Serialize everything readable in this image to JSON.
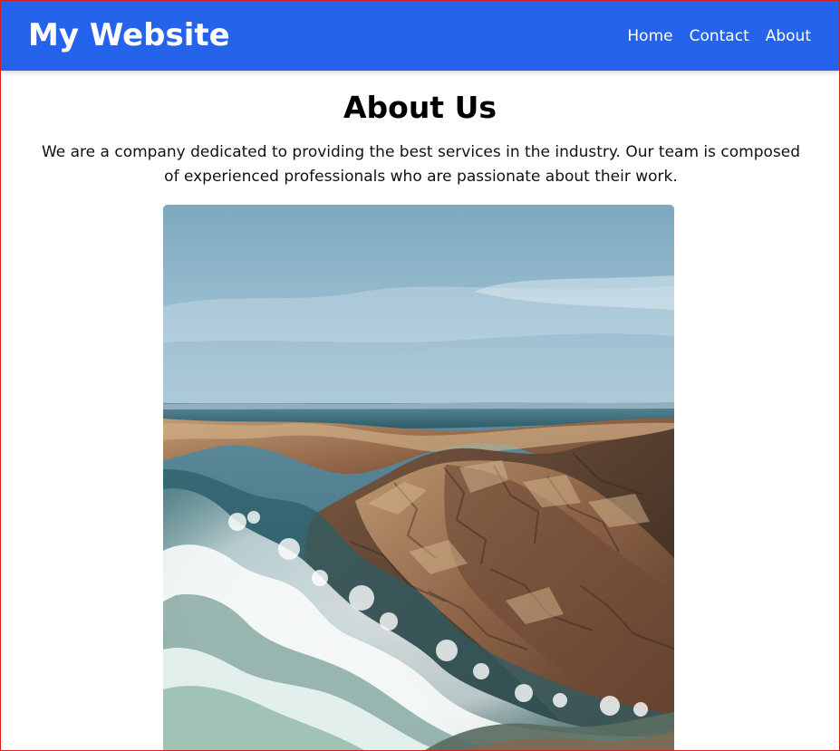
{
  "header": {
    "brand": "My Website",
    "nav": [
      {
        "label": "Home"
      },
      {
        "label": "Contact"
      },
      {
        "label": "About"
      }
    ]
  },
  "main": {
    "title": "About Us",
    "description": "We are a company dedicated to providing the best services in the industry. Our team is composed of experienced professionals who are passionate about their work.",
    "image": {
      "alt": "Coastal cliffs with crashing waves"
    }
  },
  "colors": {
    "header_bg": "#2563eb",
    "header_text": "#ffffff",
    "body_bg": "#ffffff",
    "border": "#d81b1b",
    "heading_text": "#000000"
  }
}
